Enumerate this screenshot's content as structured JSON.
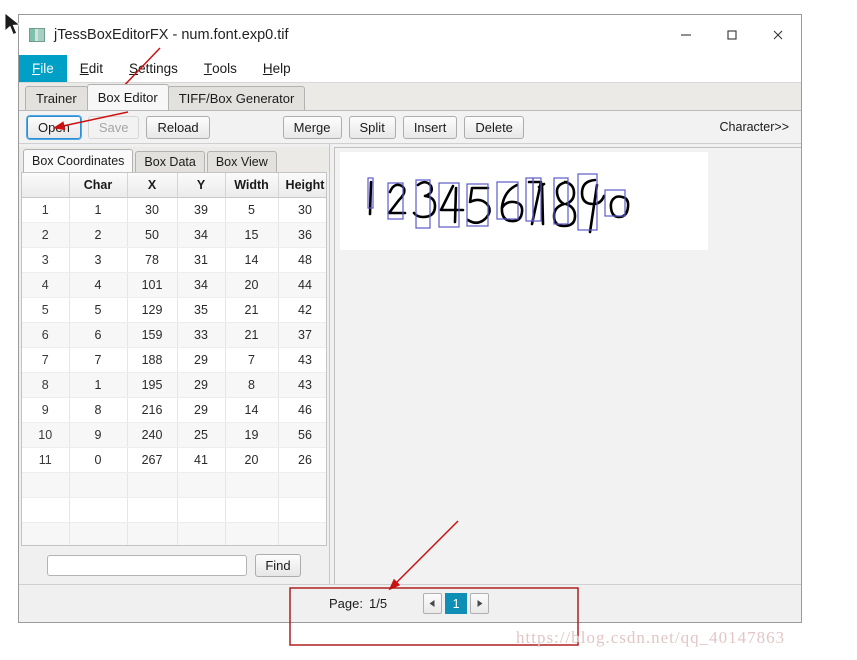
{
  "window": {
    "title": "jTessBoxEditorFX - num.font.exp0.tif",
    "icon": "app-icon",
    "controls": {
      "minimize": "minimize-icon",
      "maximize": "maximize-icon",
      "close": "close-icon"
    }
  },
  "menu": {
    "items": [
      {
        "label": "File",
        "mnemonic": "F",
        "rest": "ile",
        "active": true
      },
      {
        "label": "Edit",
        "mnemonic": "E",
        "rest": "dit",
        "active": false
      },
      {
        "label": "Settings",
        "mnemonic": "S",
        "rest": "ettings",
        "active": false
      },
      {
        "label": "Tools",
        "mnemonic": "T",
        "rest": "ools",
        "active": false
      },
      {
        "label": "Help",
        "mnemonic": "H",
        "rest": "elp",
        "active": false
      }
    ]
  },
  "tabs": {
    "items": [
      {
        "label": "Trainer",
        "selected": false
      },
      {
        "label": "Box Editor",
        "selected": true
      },
      {
        "label": "TIFF/Box Generator",
        "selected": false
      }
    ]
  },
  "toolbar": {
    "open": "Open",
    "save": "Save",
    "reload": "Reload",
    "merge": "Merge",
    "split": "Split",
    "insert": "Insert",
    "delete": "Delete",
    "character_toggle": "Character>>",
    "save_disabled": true,
    "open_focused": true
  },
  "inner_tabs": {
    "items": [
      {
        "label": "Box Coordinates",
        "selected": true
      },
      {
        "label": "Box Data",
        "selected": false
      },
      {
        "label": "Box View",
        "selected": false
      }
    ]
  },
  "table": {
    "headers": [
      "",
      "Char",
      "X",
      "Y",
      "Width",
      "Height"
    ],
    "rows": [
      {
        "index": "1",
        "char": "1",
        "x": "30",
        "y": "39",
        "width": "5",
        "height": "30"
      },
      {
        "index": "2",
        "char": "2",
        "x": "50",
        "y": "34",
        "width": "15",
        "height": "36"
      },
      {
        "index": "3",
        "char": "3",
        "x": "78",
        "y": "31",
        "width": "14",
        "height": "48"
      },
      {
        "index": "4",
        "char": "4",
        "x": "101",
        "y": "34",
        "width": "20",
        "height": "44"
      },
      {
        "index": "5",
        "char": "5",
        "x": "129",
        "y": "35",
        "width": "21",
        "height": "42"
      },
      {
        "index": "6",
        "char": "6",
        "x": "159",
        "y": "33",
        "width": "21",
        "height": "37"
      },
      {
        "index": "7",
        "char": "7",
        "x": "188",
        "y": "29",
        "width": "7",
        "height": "43"
      },
      {
        "index": "8",
        "char": "1",
        "x": "195",
        "y": "29",
        "width": "8",
        "height": "43"
      },
      {
        "index": "9",
        "char": "8",
        "x": "216",
        "y": "29",
        "width": "14",
        "height": "46"
      },
      {
        "index": "10",
        "char": "9",
        "x": "240",
        "y": "25",
        "width": "19",
        "height": "56"
      },
      {
        "index": "11",
        "char": "0",
        "x": "267",
        "y": "41",
        "width": "20",
        "height": "26"
      }
    ],
    "empty_row_count": 3
  },
  "find": {
    "value": "",
    "placeholder": "",
    "button_label": "Find"
  },
  "preview": {
    "characters": [
      "1",
      "2",
      "3",
      "4",
      "5",
      "6",
      "7",
      "1",
      "8",
      "9",
      "0"
    ],
    "box_color": "#5a5ac8",
    "background": "#ffffff"
  },
  "status": {
    "page_label": "Page:",
    "page_value": "1/5",
    "prev_icon": "triangle-left-icon",
    "next_icon": "triangle-right-icon",
    "current_page": "1"
  },
  "annotations": {
    "watermark": "https://blog.csdn.net/qq_40147863",
    "accent_color": "#00a0c6",
    "marker_color": "#cc1111"
  }
}
